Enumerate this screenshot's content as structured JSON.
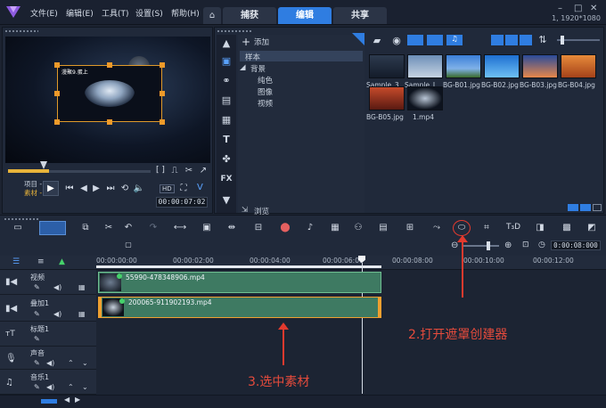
{
  "menu": {
    "file": "文件(E)",
    "edit": "编辑(E)",
    "tools": "工具(T)",
    "settings": "设置(S)",
    "help": "帮助(H)"
  },
  "tabs": {
    "capture": "捕获",
    "edit": "编辑",
    "share": "共享"
  },
  "resolution": "1, 1920*1080",
  "library": {
    "add_label": "添加",
    "tree": {
      "samples": "样本",
      "background": "背景",
      "solid": "纯色",
      "image": "图像",
      "video": "视频"
    },
    "browse": "浏览",
    "thumbs": [
      "Sample_3...",
      "Sample_L...",
      "BG-B01.jpg",
      "BG-B02.jpg",
      "BG-B03.jpg",
      "BG-B04.jpg",
      "BG-B05.jpg",
      "1.mp4"
    ]
  },
  "preview": {
    "overlay_text": "漫聚9.蛋上",
    "project_label": "项目 -",
    "clip_label": "素材 -",
    "timecode": "00:00:07:02",
    "brackets": "[ ]"
  },
  "timeline": {
    "zoom_time": "0:00:08:000",
    "ruler": [
      "00:00:00:00",
      "00:00:02:00",
      "00:00:04:00",
      "00:00:06:00",
      "00:00:08:00",
      "00:00:10:00",
      "00:00:12:00"
    ],
    "tracks": {
      "video": "视频",
      "overlay": "叠加1",
      "title": "标题1",
      "voice": "声音",
      "music": "音乐1"
    },
    "clips": {
      "video": "55990-478348906.mp4",
      "overlay": "200065-911902193.mp4"
    }
  },
  "annotations": {
    "step2": "2.打开遮罩创建器",
    "step3": "3.选中素材"
  },
  "colors": {
    "accent": "#2f7de1",
    "clip": "#3e7a62",
    "annotation": "#e64b3c",
    "handle": "#ef9a2a"
  }
}
